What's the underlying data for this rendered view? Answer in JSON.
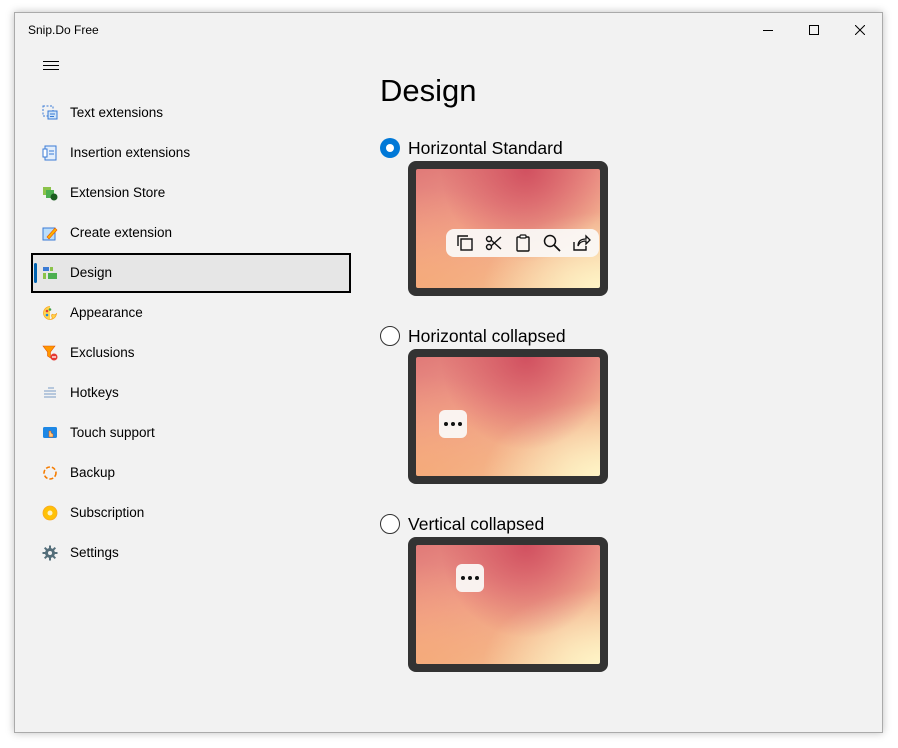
{
  "window": {
    "title": "Snip.Do Free"
  },
  "nav": {
    "items": [
      {
        "label": "Text extensions",
        "icon": "text-extensions-icon"
      },
      {
        "label": "Insertion extensions",
        "icon": "insertion-extensions-icon"
      },
      {
        "label": "Extension Store",
        "icon": "extension-store-icon"
      },
      {
        "label": "Create extension",
        "icon": "create-extension-icon"
      },
      {
        "label": "Design",
        "icon": "design-icon",
        "selected": true
      },
      {
        "label": "Appearance",
        "icon": "appearance-icon"
      },
      {
        "label": "Exclusions",
        "icon": "exclusions-icon"
      },
      {
        "label": "Hotkeys",
        "icon": "hotkeys-icon"
      },
      {
        "label": "Touch support",
        "icon": "touch-support-icon"
      },
      {
        "label": "Backup",
        "icon": "backup-icon"
      },
      {
        "label": "Subscription",
        "icon": "subscription-icon"
      },
      {
        "label": "Settings",
        "icon": "gear-icon"
      }
    ]
  },
  "main": {
    "title": "Design",
    "options": [
      {
        "label": "Horizontal Standard",
        "checked": true
      },
      {
        "label": "Horizontal collapsed",
        "checked": false
      },
      {
        "label": "Vertical collapsed",
        "checked": false
      }
    ],
    "toolbar_icons": [
      "copy-icon",
      "cut-icon",
      "paste-icon",
      "search-icon",
      "share-icon"
    ]
  },
  "colors": {
    "accent": "#0078d7",
    "selection_bar": "#0063b1",
    "window_bg": "#f2f2f2",
    "preview_frame": "#333333"
  }
}
